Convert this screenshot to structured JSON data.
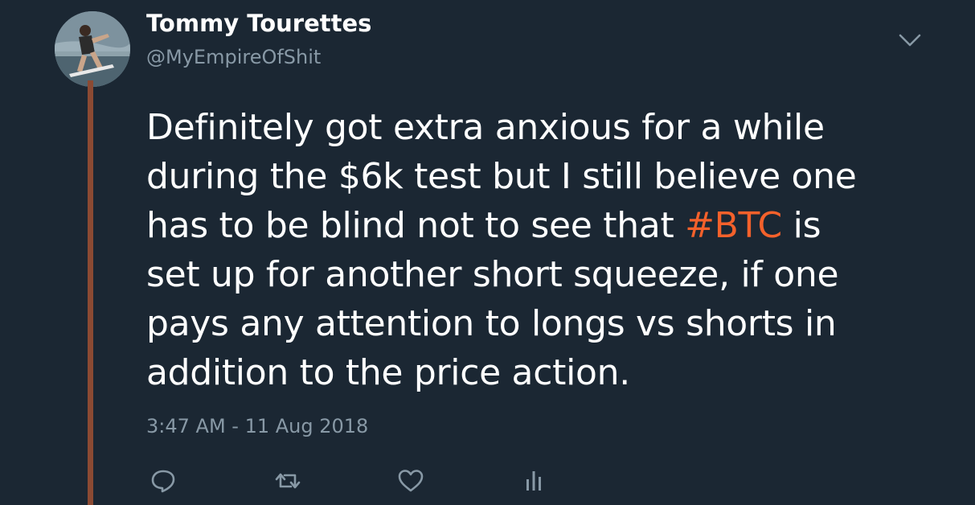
{
  "user": {
    "display_name": "Tommy Tourettes",
    "handle": "@MyEmpireOfShit",
    "avatar_icon": "avatar-photo-waterskier"
  },
  "tweet": {
    "lines": [
      "Definitely got extra anxious for a while",
      "during the $6k test but I still believe one",
      "has to be blind not to see that ",
      "set up for another short squeeze, if one",
      "pays any attention to longs vs shorts in",
      "addition to the price action."
    ],
    "hashtag": "#BTC",
    "line3_after_hashtag": " is",
    "timestamp": "3:47 AM - 11 Aug 2018"
  },
  "actions": {
    "reply_icon": "reply-icon",
    "retweet_icon": "retweet-icon",
    "like_icon": "heart-icon",
    "analytics_icon": "analytics-icon"
  },
  "colors": {
    "background": "#1b2733",
    "accent_hashtag": "#f4612b",
    "thread_line": "#8b4a33",
    "muted_text": "#8899a6"
  }
}
